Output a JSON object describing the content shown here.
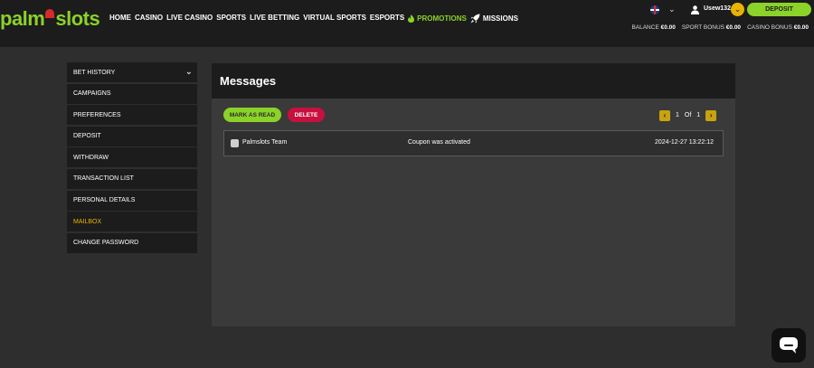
{
  "header": {
    "logo_text_a": "palm",
    "logo_text_b": "slots",
    "nav": [
      "HOME",
      "CASINO",
      "LIVE CASINO",
      "SPORTS",
      "LIVE BETTING",
      "VIRTUAL SPORTS",
      "ESPORTS"
    ],
    "nav_promotions": "PROMOTIONS",
    "nav_missions": "MISSIONS",
    "lang_chevron": "⌄",
    "username": "Usew132",
    "deposit_label": "DEPOSIT",
    "balance_label": "BALANCE",
    "balance_value": "€0.00",
    "sport_bonus_label": "SPORT BONUS",
    "sport_bonus_value": "€0.00",
    "casino_bonus_label": "CASINO BONUS",
    "casino_bonus_value": "€0.00"
  },
  "sidebar": {
    "items": [
      {
        "label": "BET HISTORY"
      },
      {
        "label": "CAMPAIGNS"
      },
      {
        "label": "PREFERENCES"
      },
      {
        "label": "DEPOSIT"
      },
      {
        "label": "WITHDRAW"
      },
      {
        "label": "TRANSACTION LIST"
      },
      {
        "label": "PERSONAL DETAILS"
      },
      {
        "label": "MAILBOX"
      },
      {
        "label": "CHANGE PASSWORD"
      }
    ],
    "active_index": 7
  },
  "main": {
    "title": "Messages",
    "mark_read_label": "MARK AS READ",
    "delete_label": "DELETE",
    "pager": {
      "current": "1",
      "of_label": "Of",
      "total": "1"
    },
    "messages": [
      {
        "sender": "Palmslots Team",
        "subject": "Coupon was activated",
        "date": "2024-12-27 13:22:12"
      }
    ]
  },
  "colors": {
    "brand_green": "#8bd229",
    "accent_yellow": "#e8b400",
    "delete_red": "#c8103e",
    "header_bg": "#1c1c1c",
    "page_bg": "#2e2e2e"
  }
}
